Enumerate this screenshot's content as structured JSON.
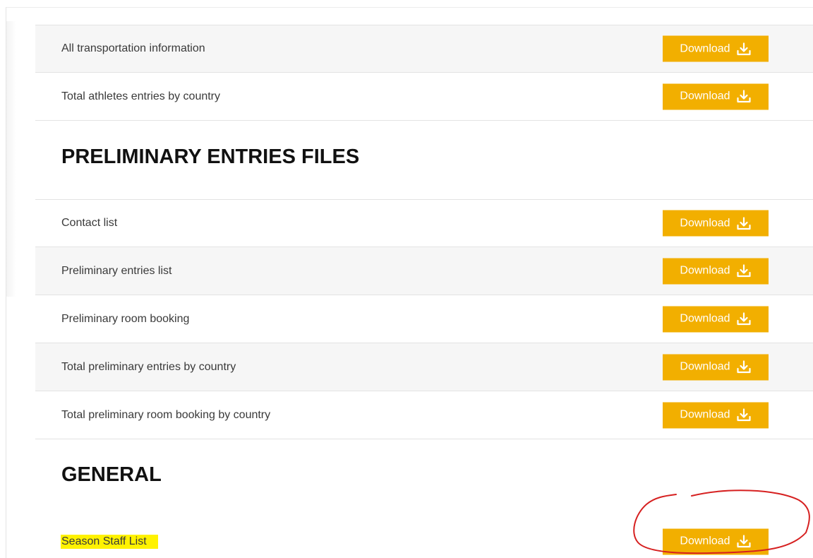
{
  "accent_color": "#f2af00",
  "highlight_color": "#fff200",
  "annotation_color": "#d62020",
  "download_label": "Download",
  "download_icon": "download-arrow-icon",
  "top_rows": [
    {
      "label": "All transportation information"
    },
    {
      "label": "Total athletes entries by country"
    }
  ],
  "sections": [
    {
      "heading": "PRELIMINARY ENTRIES FILES",
      "rows": [
        {
          "label": "Contact list"
        },
        {
          "label": "Preliminary entries list"
        },
        {
          "label": "Preliminary room booking"
        },
        {
          "label": "Total preliminary entries by country"
        },
        {
          "label": "Total preliminary room booking by country"
        }
      ]
    },
    {
      "heading": "GENERAL",
      "rows": [
        {
          "label": "Season Staff List"
        }
      ]
    }
  ]
}
